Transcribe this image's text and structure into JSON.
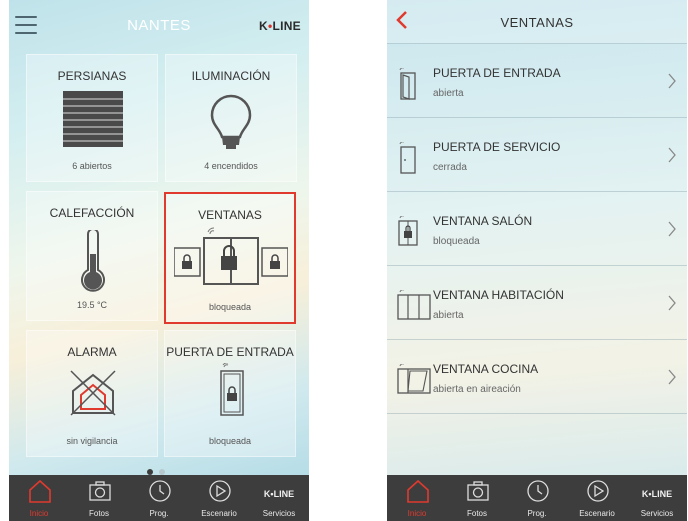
{
  "home": {
    "title": "NANTES",
    "brand_k": "K",
    "brand_dot": "•",
    "brand_line": "LINE",
    "tiles": [
      {
        "title": "PERSIANAS",
        "status": "6 abiertos",
        "icon": "shutter-icon"
      },
      {
        "title": "ILUMINACIÓN",
        "status": "4 encendidos",
        "icon": "bulb-icon"
      },
      {
        "title": "CALEFACCIÓN",
        "status": "19.5 °C",
        "icon": "thermometer-icon"
      },
      {
        "title": "VENTANAS",
        "status": "bloqueada",
        "icon": "window-lock-icon"
      },
      {
        "title": "ALARMA",
        "status": "sin vigilancia",
        "icon": "house-alarm-icon"
      },
      {
        "title": "PUERTA DE ENTRADA",
        "status": "bloqueada",
        "icon": "door-lock-icon"
      }
    ],
    "page_count": 2,
    "current_page": 1
  },
  "windows": {
    "title": "VENTANAS",
    "items": [
      {
        "name": "PUERTA DE ENTRADA",
        "status": "abierta",
        "icon": "door-open-icon"
      },
      {
        "name": "PUERTA DE SERVICIO",
        "status": "cerrada",
        "icon": "door-closed-icon"
      },
      {
        "name": "VENTANA SALÓN",
        "status": "bloqueada",
        "icon": "window-locked-icon"
      },
      {
        "name": "VENTANA HABITACIÓN",
        "status": "abierta",
        "icon": "window-open-icon"
      },
      {
        "name": "VENTANA COCINA",
        "status": "abierta en aireación",
        "icon": "window-tilt-icon"
      }
    ]
  },
  "nav": {
    "items": [
      {
        "label": "Inicio",
        "icon": "home-icon"
      },
      {
        "label": "Fotos",
        "icon": "camera-icon"
      },
      {
        "label": "Prog.",
        "icon": "clock-icon"
      },
      {
        "label": "Escenario",
        "icon": "play-icon"
      },
      {
        "label": "Servicios",
        "icon": "kline-logo"
      }
    ],
    "logo_text": "K•LINE"
  },
  "colors": {
    "accent": "#e03a2f",
    "bar": "#3d3d3d",
    "text": "#333333"
  }
}
